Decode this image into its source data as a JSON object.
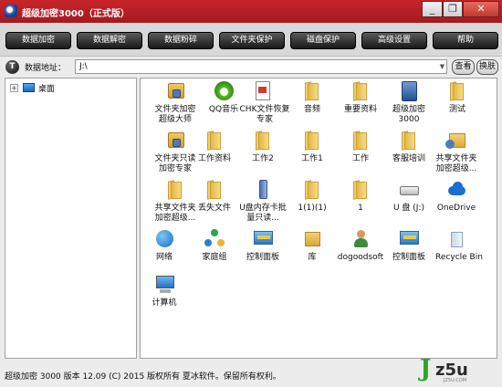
{
  "window": {
    "title": "超级加密3000（正式版）",
    "controls": {
      "minimize": "_",
      "maximize": "❐",
      "close": "✕"
    }
  },
  "toolbar": {
    "buttons": [
      "数据加密",
      "数据解密",
      "数据粉碎",
      "文件夹保护",
      "磁盘保护",
      "高级设置",
      "帮助"
    ]
  },
  "address": {
    "icon_text": "T",
    "label": "数据地址：",
    "value": "J:\\",
    "dropdown": "▼",
    "view_button": "查看",
    "skin_button": "换肤"
  },
  "tree": {
    "expander": "+",
    "root_label": "桌面",
    "root_icon": "desktop-icon"
  },
  "files": [
    {
      "label": "文件夹加密超级大师",
      "icon": "folder-lock-icon"
    },
    {
      "label": "QQ音乐",
      "icon": "qq-music-icon"
    },
    {
      "label": "CHK文件恢复专家",
      "icon": "chk-file-icon"
    },
    {
      "label": "音频",
      "icon": "folder-icon"
    },
    {
      "label": "重要资料",
      "icon": "folder-icon"
    },
    {
      "label": "超级加密3000",
      "icon": "super-encrypt-icon"
    },
    {
      "label": "测试",
      "icon": "folder-icon"
    },
    {
      "label": "文件夹只读加密专家",
      "icon": "folder-lock-icon"
    },
    {
      "label": "工作资料",
      "icon": "folder-icon"
    },
    {
      "label": "工作2",
      "icon": "folder-icon"
    },
    {
      "label": "工作1",
      "icon": "folder-icon"
    },
    {
      "label": "工作",
      "icon": "folder-icon"
    },
    {
      "label": "客服培训",
      "icon": "folder-icon"
    },
    {
      "label": "共享文件夹加密超级...",
      "icon": "share-folder-icon"
    },
    {
      "label": "共享文件夹加密超级...",
      "icon": "folder-icon"
    },
    {
      "label": "丢失文件",
      "icon": "folder-icon"
    },
    {
      "label": "U盘内存卡批量只读...",
      "icon": "usb-icon"
    },
    {
      "label": "1(1)(1)",
      "icon": "folder-icon"
    },
    {
      "label": "1",
      "icon": "folder-icon"
    },
    {
      "label": "U 盘 (J:)",
      "icon": "drive-icon"
    },
    {
      "label": "OneDrive",
      "icon": "onedrive-icon"
    },
    {
      "label": "网络",
      "icon": "network-icon"
    },
    {
      "label": "家庭组",
      "icon": "homegroup-icon"
    },
    {
      "label": "控制面板",
      "icon": "control-panel-icon"
    },
    {
      "label": "库",
      "icon": "library-icon"
    },
    {
      "label": "dogoodsoft",
      "icon": "user-icon"
    },
    {
      "label": "控制面板",
      "icon": "control-panel-icon"
    },
    {
      "label": "Recycle Bin",
      "icon": "recycle-bin-icon"
    },
    {
      "label": "计算机",
      "icon": "computer-icon"
    }
  ],
  "status": "超级加密 3000 版本 12.09 (C) 2015 版权所有 夏冰软件。保留所有权利。",
  "watermark": {
    "j": "J",
    "rest": "z5u",
    "domain": "JZ5U.COM"
  },
  "colors": {
    "titlebar": "#b01f25",
    "toolbar_button": "#1f1f1f",
    "folder": "#f1cf68"
  }
}
